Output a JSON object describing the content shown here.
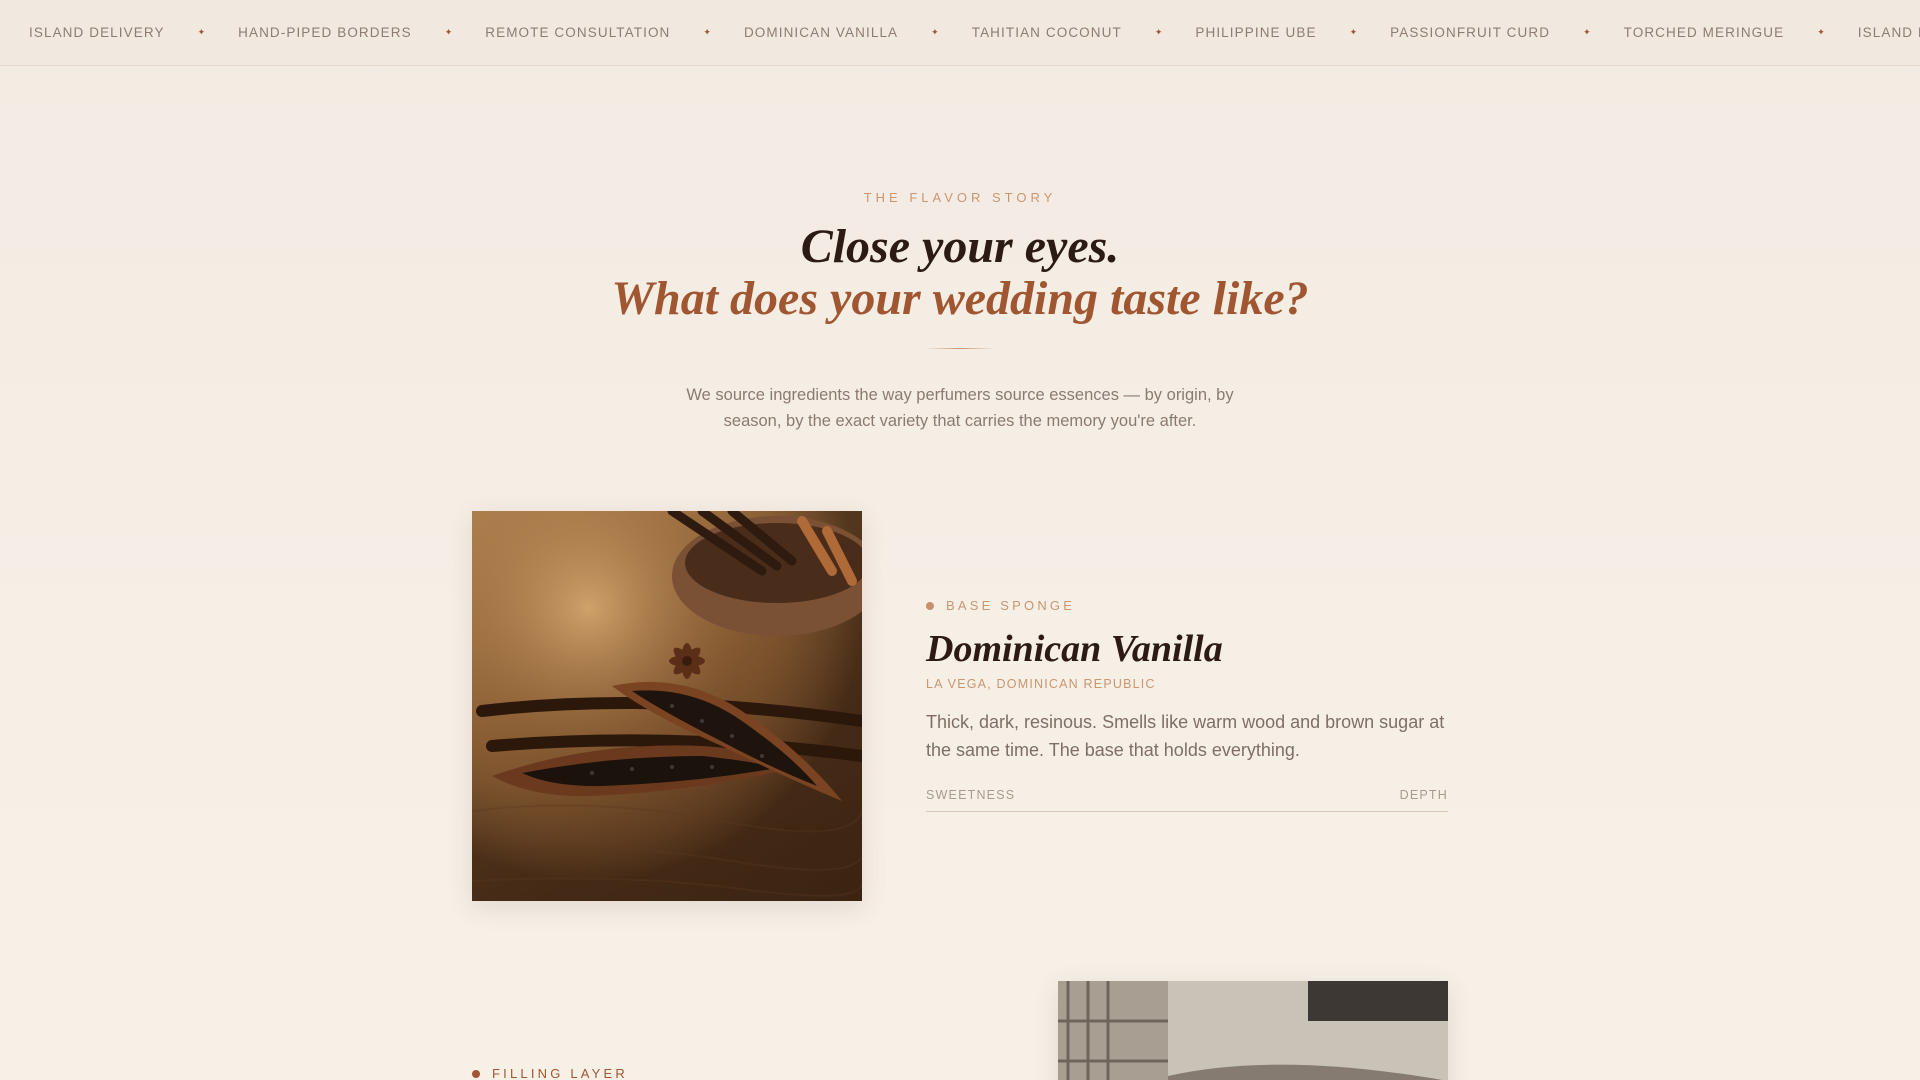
{
  "marquee": {
    "items": [
      "ISLAND DELIVERY",
      "HAND-PIPED BORDERS",
      "REMOTE CONSULTATION",
      "DOMINICAN VANILLA",
      "TAHITIAN COCONUT",
      "PHILIPPINE UBE",
      "PASSIONFRUIT CURD",
      "TORCHED MERINGUE",
      "ISLAND DELIVERY"
    ],
    "separator": "✦"
  },
  "intro": {
    "eyebrow": "THE FLAVOR STORY",
    "headline_line1": "Close your eyes.",
    "headline_line2": "What does your wedding taste like?",
    "lede": "We source ingredients the way perfumers source essences — by origin, by season, by the exact variety that carries the memory you're after."
  },
  "flavors": [
    {
      "layer": "BASE SPONGE",
      "name": "Dominican Vanilla",
      "origin": "LA VEGA, DOMINICAN REPUBLIC",
      "description": "Thick, dark, resinous. Smells like warm wood and brown sugar at the same time. The base that holds everything.",
      "scale_left": "SWEETNESS",
      "scale_right": "DEPTH"
    },
    {
      "layer": "FILLING LAYER"
    }
  ],
  "colors": {
    "accent": "#a05731",
    "accent_light": "#c99670",
    "ink": "#2b1b14",
    "background": "#f4ede5"
  }
}
